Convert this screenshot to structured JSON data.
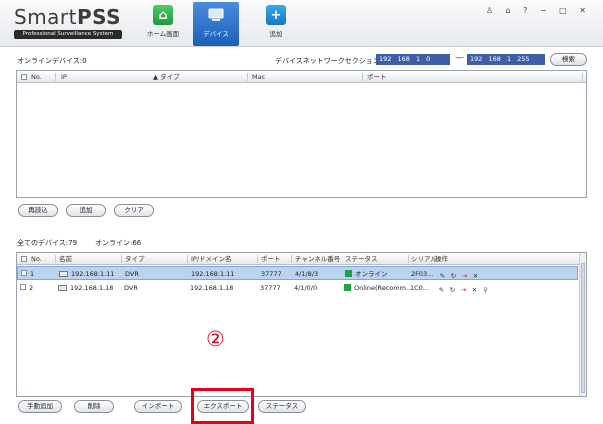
{
  "app": {
    "logo_main": "SmartPSS",
    "logo_sub": "Professional Surveillance System",
    "window_controls": "♙ ⌂ ? − □ ✕"
  },
  "nav": {
    "home": "ホーム画面",
    "device": "デバイス",
    "add": "追加"
  },
  "online": {
    "label": "オンラインデバイス:0",
    "network_label": "デバイスネットワークセクション:",
    "ip_start": "192 168 1 0",
    "ip_end": "192 168 1 255",
    "search_button": "検索",
    "columns": [
      "No.",
      "IP",
      "▲ タイプ",
      "Mac",
      "ポート"
    ],
    "buttons": [
      "再読込",
      "追加",
      "クリア"
    ]
  },
  "all": {
    "label": "全てのデバイス:79",
    "online_count": "オンライン:66",
    "columns": [
      "No.",
      "名前",
      "タイプ",
      "IP/ドメイン名",
      "ポート",
      "チャンネル番号",
      "ステータス",
      "シリアル",
      "操作"
    ],
    "rows": [
      {
        "no": "1",
        "name": "192.168.1.11",
        "type": "DVR",
        "ip": "192.168.1.11",
        "port": "37777",
        "channel": "4/1/8/3",
        "status": "オンライン",
        "serial": "2F03..."
      },
      {
        "no": "2",
        "name": "192.168.1.18",
        "type": "DVR",
        "ip": "192.168.1.18",
        "port": "37777",
        "channel": "4/1/0/0",
        "status": "Online(Recomm...",
        "serial": "1C0..."
      }
    ],
    "buttons": [
      "手動追加",
      "削除",
      "インポート",
      "エクスポート",
      "ステータス"
    ]
  },
  "annotation": {
    "number": "②"
  },
  "colors": {
    "accent": "#3f5ea8",
    "online_status": "#1fa33e",
    "highlight": "#e3001b",
    "selected_row": "#b9d3f0"
  }
}
